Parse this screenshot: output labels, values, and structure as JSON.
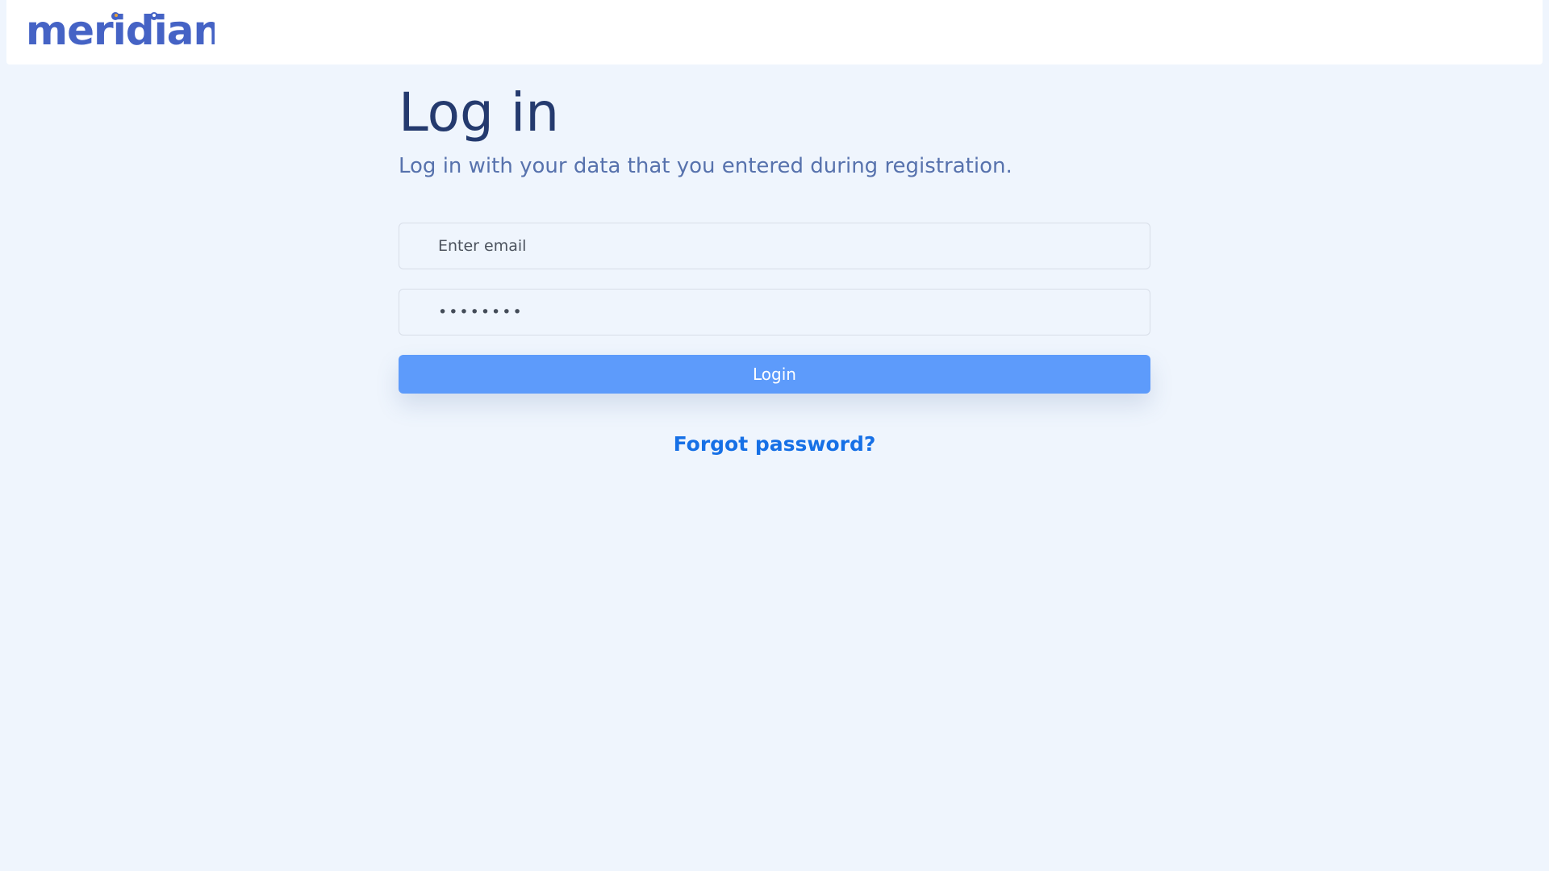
{
  "header": {
    "logo_text": "meridian"
  },
  "login": {
    "title": "Log in",
    "subtitle": "Log in with your data that you entered during registration.",
    "email": {
      "placeholder": "Enter email",
      "value": ""
    },
    "password": {
      "value": "secret12",
      "placeholder": ""
    },
    "button_label": "Login",
    "forgot_label": "Forgot password?"
  },
  "colors": {
    "background": "#eff5fd",
    "header": "#ffffff",
    "brand": "#4563c5",
    "title": "#243a6e",
    "subtitle": "#5772ad",
    "button": "#5d9bfb",
    "link": "#1670e6"
  }
}
